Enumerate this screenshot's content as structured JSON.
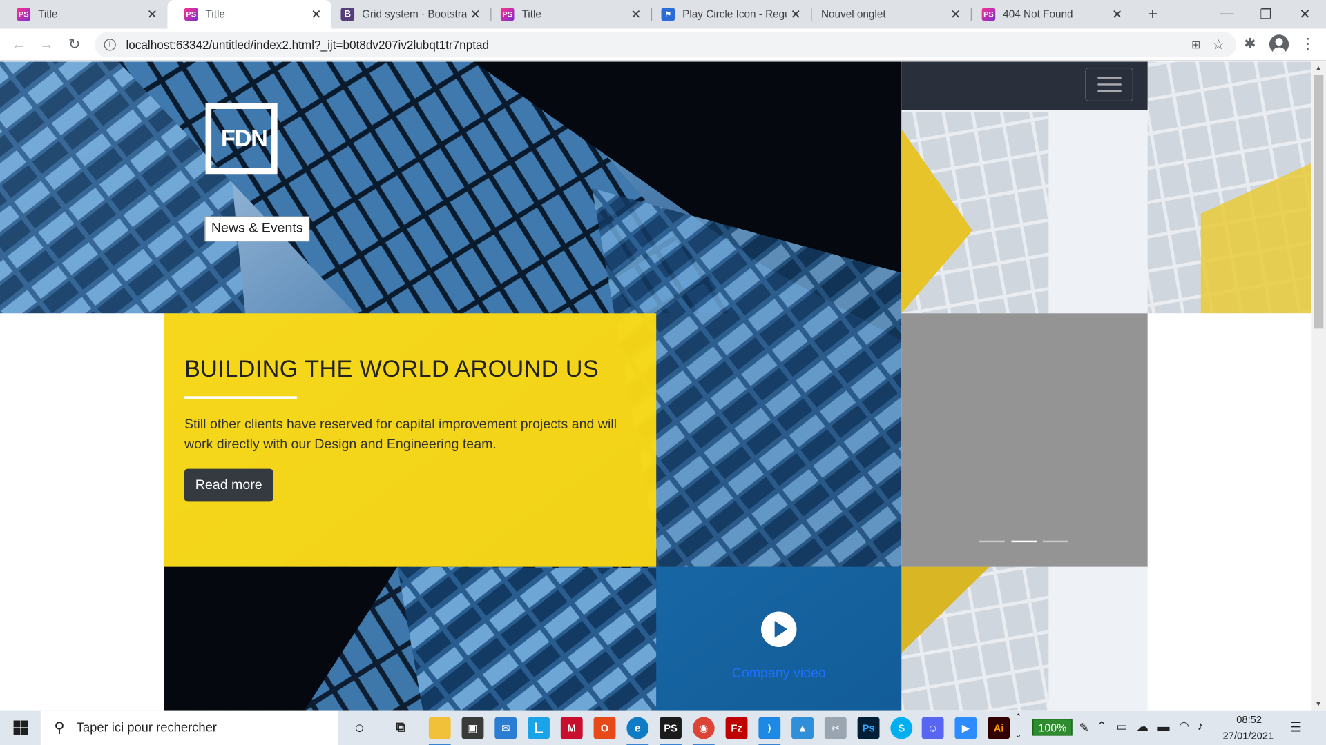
{
  "browser": {
    "tabs": [
      {
        "title": "Title",
        "favicon": "phpstorm-icon",
        "active": false
      },
      {
        "title": "Title",
        "favicon": "phpstorm-icon",
        "active": true
      },
      {
        "title": "Grid system · Bootstrap",
        "favicon": "bootstrap-icon",
        "active": false
      },
      {
        "title": "Title",
        "favicon": "phpstorm-icon",
        "active": false
      },
      {
        "title": "Play Circle Icon - Regul",
        "favicon": "fontawesome-flag-icon",
        "active": false
      },
      {
        "title": "Nouvel onglet",
        "favicon": "",
        "active": false
      },
      {
        "title": "404 Not Found",
        "favicon": "phpstorm-icon",
        "active": false
      }
    ],
    "url": "localhost:63342/untitled/index2.html?_ijt=b0t8dv207iv2lubqt1tr7nptad"
  },
  "page": {
    "logo_text": "FDN",
    "news_button": "News & Events",
    "hero": {
      "title": "BUILDING THE WORLD AROUND US",
      "body": "Still other clients have reserved for capital improvement projects and will work directly with our Design and Engineering team.",
      "cta": "Read more"
    },
    "carousel": {
      "slides": 3,
      "active_index": 1
    },
    "video_link": "Company video"
  },
  "taskbar": {
    "search_placeholder": "Taper ici pour rechercher",
    "zoom": "100%",
    "time": "08:52",
    "date": "27/01/2021"
  },
  "colors": {
    "hero_yellow": "#fdda12",
    "button_dark": "#343a40",
    "video_blue": "#146eb4",
    "carousel_gray": "#949494"
  }
}
